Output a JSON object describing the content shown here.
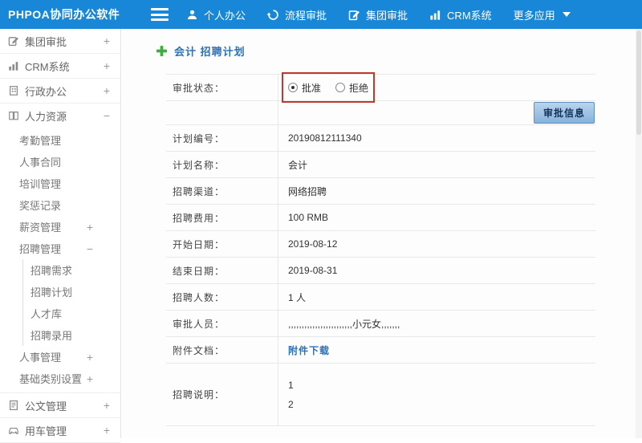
{
  "topbar": {
    "brand": "PHPOA协同办公软件",
    "nav": [
      {
        "label": "个人办公",
        "icon": "person-icon"
      },
      {
        "label": "流程审批",
        "icon": "cycle-icon"
      },
      {
        "label": "集团审批",
        "icon": "edit-icon"
      },
      {
        "label": "CRM系统",
        "icon": "bar-chart-icon"
      },
      {
        "label": "更多应用",
        "icon": "caret-down-icon"
      }
    ]
  },
  "sidebar": {
    "groups": [
      {
        "label": "集团审批",
        "toggle": "+"
      },
      {
        "label": "CRM系统",
        "toggle": "+"
      },
      {
        "label": "行政办公",
        "toggle": "+"
      },
      {
        "label": "人力资源",
        "toggle": "−"
      },
      {
        "label": "公文管理",
        "toggle": "+"
      },
      {
        "label": "用车管理",
        "toggle": "+"
      }
    ],
    "hr_children": [
      {
        "label": "考勤管理",
        "toggle": ""
      },
      {
        "label": "人事合同",
        "toggle": ""
      },
      {
        "label": "培训管理",
        "toggle": ""
      },
      {
        "label": "奖惩记录",
        "toggle": ""
      },
      {
        "label": "薪资管理",
        "toggle": "+"
      },
      {
        "label": "招聘管理",
        "toggle": "−"
      },
      {
        "label": "人事管理",
        "toggle": "+"
      },
      {
        "label": "基础类别设置",
        "toggle": "+"
      }
    ],
    "recruit_children": [
      {
        "label": "招聘需求"
      },
      {
        "label": "招聘计划"
      },
      {
        "label": "人才库"
      },
      {
        "label": "招聘录用"
      }
    ]
  },
  "main": {
    "title": "会计 招聘计划",
    "approval": {
      "label": "审批状态：",
      "options": [
        {
          "label": "批准",
          "checked": true
        },
        {
          "label": "拒绝",
          "checked": false
        }
      ],
      "button_label": "审批信息"
    },
    "rows": [
      {
        "label": "计划编号：",
        "value": "20190812111340"
      },
      {
        "label": "计划名称：",
        "value": "会计"
      },
      {
        "label": "招聘渠道：",
        "value": "网络招聘"
      },
      {
        "label": "招聘费用：",
        "value": "100 RMB"
      },
      {
        "label": "开始日期：",
        "value": "2019-08-12"
      },
      {
        "label": "结束日期：",
        "value": "2019-08-31"
      },
      {
        "label": "招聘人数：",
        "value": "1 人"
      },
      {
        "label": "审批人员：",
        "value": ",,,,,,,,,,,,,,,,,,,,,,,,小元女,,,,,,,"
      },
      {
        "label": "附件文档：",
        "value": "附件下载"
      },
      {
        "label": "招聘说明：",
        "value": "1\n2"
      }
    ]
  },
  "colors": {
    "topbar_blue": "#1987d8",
    "title_blue": "#2f71b3",
    "annotation_red": "#c0392b",
    "plus_green": "#3fae3f"
  }
}
